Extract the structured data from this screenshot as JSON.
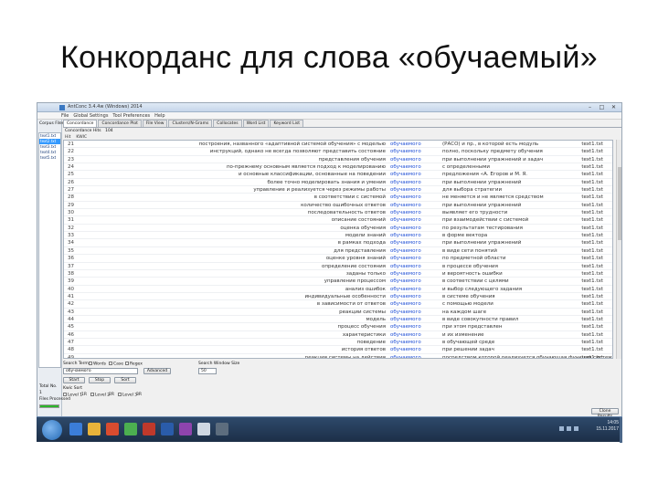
{
  "slide": {
    "title": "Конкорданс для слова «обучаемый»"
  },
  "window": {
    "title": "AntConc 3.4.4w (Windows) 2014",
    "controls": [
      "–",
      "□",
      "✕"
    ]
  },
  "menu": [
    "File",
    "Global Settings",
    "Tool Preferences",
    "Help"
  ],
  "corpus_panel": {
    "header": "Corpus Files",
    "files": [
      "text1.txt",
      "text2.txt",
      "text3.txt",
      "text4.txt",
      "text5.txt"
    ],
    "selected_index": 1,
    "total_label": "Total No.",
    "total_value": "1",
    "files_processed_label": "Files Processed",
    "progress_fraction": 1.0
  },
  "tabs": [
    "Concordance",
    "Concordance Plot",
    "File View",
    "Clusters/N-Grams",
    "Collocates",
    "Word List",
    "Keyword List"
  ],
  "active_tab_index": 0,
  "hits": {
    "label": "Concordance Hits",
    "value": "104"
  },
  "columns": [
    "Hit",
    "KWIC"
  ],
  "concordance": [
    {
      "n": "21",
      "left": "построения, названного «адаптивной системой обучения» с моделью",
      "hit": "обучаемого",
      "right": "(РАСО) и пр., в которой есть модуль",
      "file": "text1.txt"
    },
    {
      "n": "22",
      "left": "инструкций, однако не всегда позволяют представить состояние",
      "hit": "обучаемого",
      "right": "полно, поскольку предмету обучения",
      "file": "text1.txt"
    },
    {
      "n": "23",
      "left": "представления обучения",
      "hit": "обучаемого",
      "right": "при выполнении упражнений и задач",
      "file": "text1.txt"
    },
    {
      "n": "24",
      "left": "по-прежнему основным является подход к моделированию",
      "hit": "обучаемого",
      "right": "с определенными",
      "file": "text1.txt"
    },
    {
      "n": "25",
      "left": "и основные классификации, основанные на поведении",
      "hit": "обучаемого",
      "right": "предложения «А. Егоров и М. Я.",
      "file": "text1.txt"
    },
    {
      "n": "26",
      "left": "более точно моделировать знания и умения",
      "hit": "обучаемого",
      "right": "при выполнении упражнений",
      "file": "text1.txt"
    },
    {
      "n": "27",
      "left": "управление и реализуется через режимы работы",
      "hit": "обучаемого",
      "right": "для выбора стратегии",
      "file": "text1.txt"
    },
    {
      "n": "28",
      "left": "в соответствии с системой",
      "hit": "обучаемого",
      "right": "не меняется и не является средством",
      "file": "text1.txt"
    },
    {
      "n": "29",
      "left": "количество ошибочных ответов",
      "hit": "обучаемого",
      "right": "при выполнении упражнений",
      "file": "text1.txt"
    },
    {
      "n": "30",
      "left": "последовательность ответов",
      "hit": "обучаемого",
      "right": "выявляет его трудности",
      "file": "text1.txt"
    },
    {
      "n": "31",
      "left": "описание состояний",
      "hit": "обучаемого",
      "right": "при взаимодействии с системой",
      "file": "text1.txt"
    },
    {
      "n": "32",
      "left": "оценка обучения",
      "hit": "обучаемого",
      "right": "по результатам тестирования",
      "file": "text1.txt"
    },
    {
      "n": "33",
      "left": "модели знаний",
      "hit": "обучаемого",
      "right": "в форме вектора",
      "file": "text1.txt"
    },
    {
      "n": "34",
      "left": "в рамках подхода",
      "hit": "обучаемого",
      "right": "при выполнении упражнений",
      "file": "text1.txt"
    },
    {
      "n": "35",
      "left": "для представления",
      "hit": "обучаемого",
      "right": "в виде сети понятий",
      "file": "text1.txt"
    },
    {
      "n": "36",
      "left": "оценке уровня знаний",
      "hit": "обучаемого",
      "right": "по предметной области",
      "file": "text1.txt"
    },
    {
      "n": "37",
      "left": "определение состояния",
      "hit": "обучаемого",
      "right": "в процессе обучения",
      "file": "text1.txt"
    },
    {
      "n": "38",
      "left": "заданы только",
      "hit": "обучаемого",
      "right": "и вероятность ошибки",
      "file": "text1.txt"
    },
    {
      "n": "39",
      "left": "управление процессом",
      "hit": "обучаемого",
      "right": "в соответствии с целями",
      "file": "text1.txt"
    },
    {
      "n": "40",
      "left": "анализ ошибок",
      "hit": "обучаемого",
      "right": "и выбор следующего задания",
      "file": "text1.txt"
    },
    {
      "n": "41",
      "left": "индивидуальные особенности",
      "hit": "обучаемого",
      "right": "в системе обучения",
      "file": "text1.txt"
    },
    {
      "n": "42",
      "left": "в зависимости от ответов",
      "hit": "обучаемого",
      "right": "с помощью модели",
      "file": "text1.txt"
    },
    {
      "n": "43",
      "left": "реакции системы",
      "hit": "обучаемого",
      "right": "на каждом шаге",
      "file": "text1.txt"
    },
    {
      "n": "44",
      "left": "модель",
      "hit": "обучаемого",
      "right": "в виде совокупности правил",
      "file": "text1.txt"
    },
    {
      "n": "45",
      "left": "процесс обучения",
      "hit": "обучаемого",
      "right": "при этом представлен",
      "file": "text1.txt"
    },
    {
      "n": "46",
      "left": "характеристики",
      "hit": "обучаемого",
      "right": "и их изменение",
      "file": "text1.txt"
    },
    {
      "n": "47",
      "left": "поведение",
      "hit": "обучаемого",
      "right": "в обучающей среде",
      "file": "text1.txt"
    },
    {
      "n": "48",
      "left": "история ответов",
      "hit": "обучаемого",
      "right": "при решении задач",
      "file": "text1.txt"
    },
    {
      "n": "49",
      "left": "реакция системы на действия",
      "hit": "обучаемого",
      "right": "посредством которой реализуется обучающая функция системы",
      "file": "text1.txt"
    }
  ],
  "search": {
    "term_label": "Search Term",
    "options": [
      "Words",
      "Case",
      "Regex"
    ],
    "window_label": "Search Window Size",
    "term_value": "обучаемого",
    "advanced_label": "Advanced",
    "window_value": "50",
    "start_label": "Start",
    "stop_label": "Stop",
    "sort_label": "Sort",
    "kwic_sort_label": "Kwic Sort",
    "levels": [
      "Level 1",
      "1R",
      "Level 2",
      "2R",
      "Level 3",
      "3R"
    ],
    "clone_label": "Clone Results"
  },
  "taskbar": {
    "time": "14:05",
    "date": "15.11.2017"
  },
  "colors": {
    "hit_blue": "#1f4fd6",
    "selection": "#3399ff",
    "progress_green": "#2bb52b",
    "taskbar_dark": "#1c2f47"
  }
}
